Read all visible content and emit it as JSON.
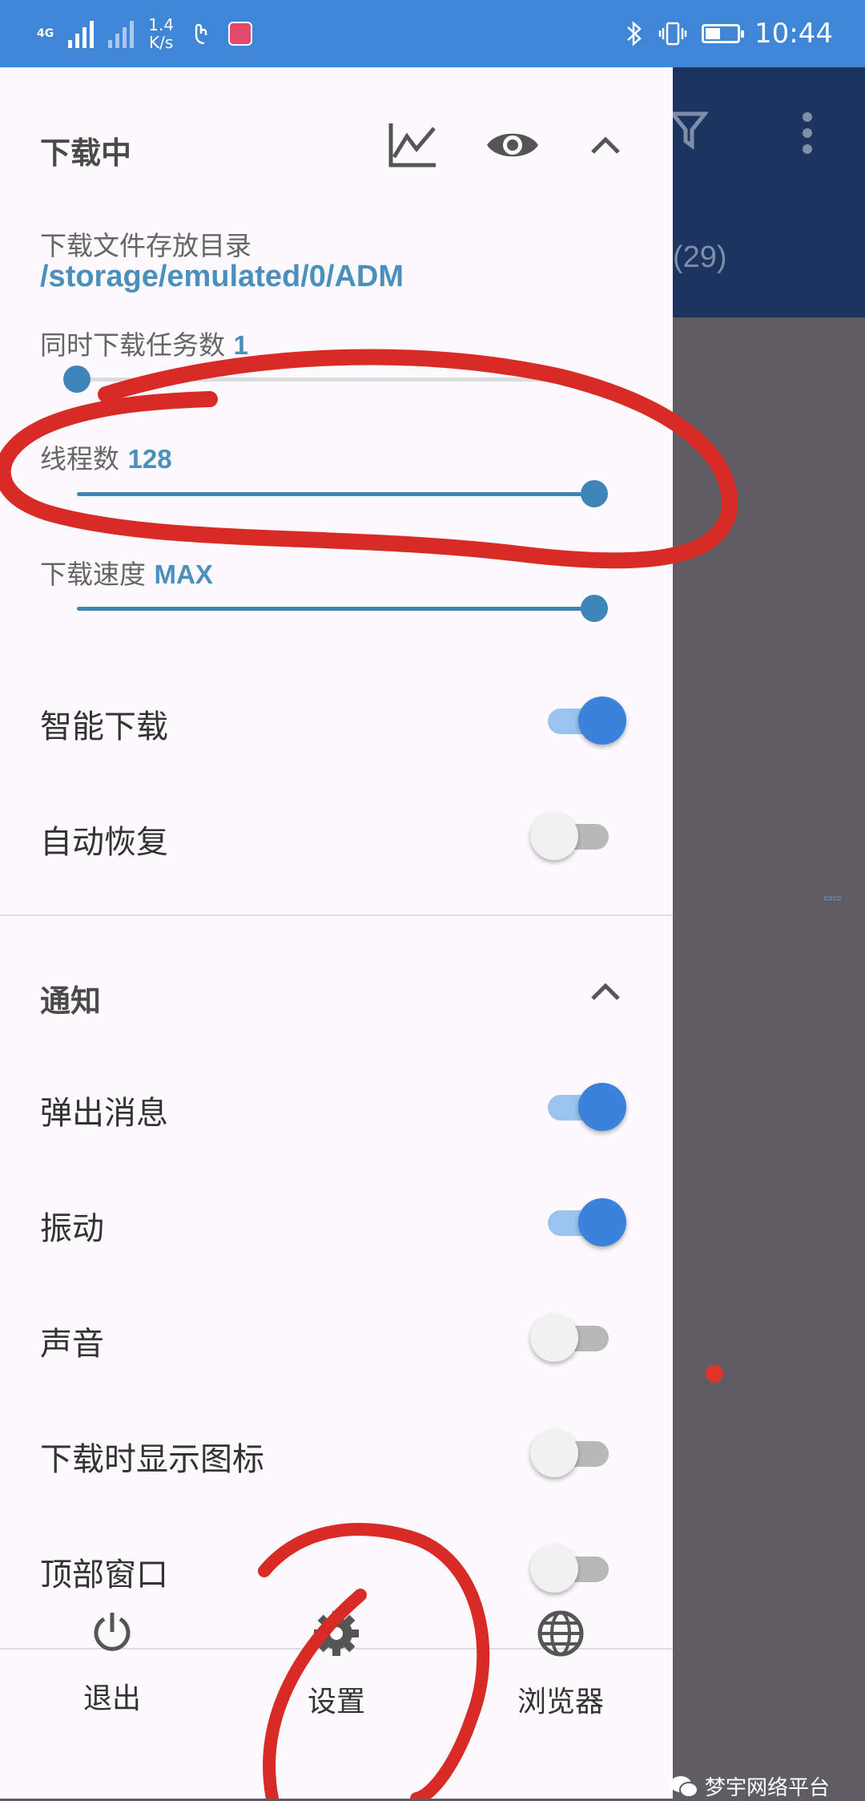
{
  "status_bar": {
    "network_type": "4G",
    "net_speed_value": "1.4",
    "net_speed_unit": "K/s",
    "time": "10:44"
  },
  "drawer": {
    "downloading_section": {
      "title": "下载中",
      "storage_label": "下载文件存放目录",
      "storage_path": "/storage/emulated/0/ADM",
      "concurrent_label": "同时下载任务数",
      "concurrent_value": "1",
      "concurrent_level": 0.0,
      "threads_label": "线程数",
      "threads_value": "128",
      "threads_level": 1.0,
      "speed_label": "下载速度",
      "speed_value": "MAX",
      "speed_level": 1.0,
      "smart_download_label": "智能下载",
      "smart_download_on": true,
      "auto_resume_label": "自动恢复",
      "auto_resume_on": false
    },
    "notify_section": {
      "title": "通知",
      "popup_label": "弹出消息",
      "popup_on": true,
      "vibrate_label": "振动",
      "vibrate_on": true,
      "sound_label": "声音",
      "sound_on": false,
      "show_icon_label": "下载时显示图标",
      "show_icon_on": false,
      "top_window_label": "顶部窗口",
      "top_window_on": false
    },
    "bottom_nav": {
      "exit_label": "退出",
      "settings_label": "设置",
      "browser_label": "浏览器"
    }
  },
  "underlay": {
    "count_text": "(29)"
  },
  "watermark": {
    "text": "梦宇网络平台"
  },
  "colors": {
    "status_bar": "#3f86d6",
    "accent": "#3a82dc",
    "value_text": "#4b8fbf",
    "annotation": "#d92b25"
  }
}
